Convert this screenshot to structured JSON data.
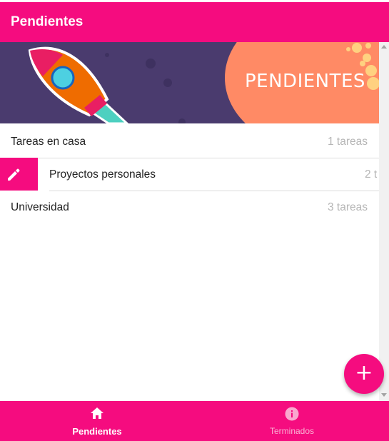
{
  "header": {
    "title": "Pendientes"
  },
  "banner": {
    "text": "PENDIENTES"
  },
  "list": {
    "items": [
      {
        "name": "Tareas en casa",
        "count": "1 tareas"
      },
      {
        "name": "Proyectos personales",
        "count": "2 t"
      },
      {
        "name": "Universidad",
        "count": "3 tareas"
      }
    ]
  },
  "fab": {
    "label": "+"
  },
  "bottom_nav": {
    "tabs": [
      {
        "label": "Pendientes",
        "icon": "home-icon",
        "active": true
      },
      {
        "label": "Terminados",
        "icon": "info-icon",
        "active": false
      }
    ]
  },
  "colors": {
    "primary": "#f50c7f",
    "banner_bg": "#4a3b6e",
    "banner_accent": "#ff8a65"
  }
}
